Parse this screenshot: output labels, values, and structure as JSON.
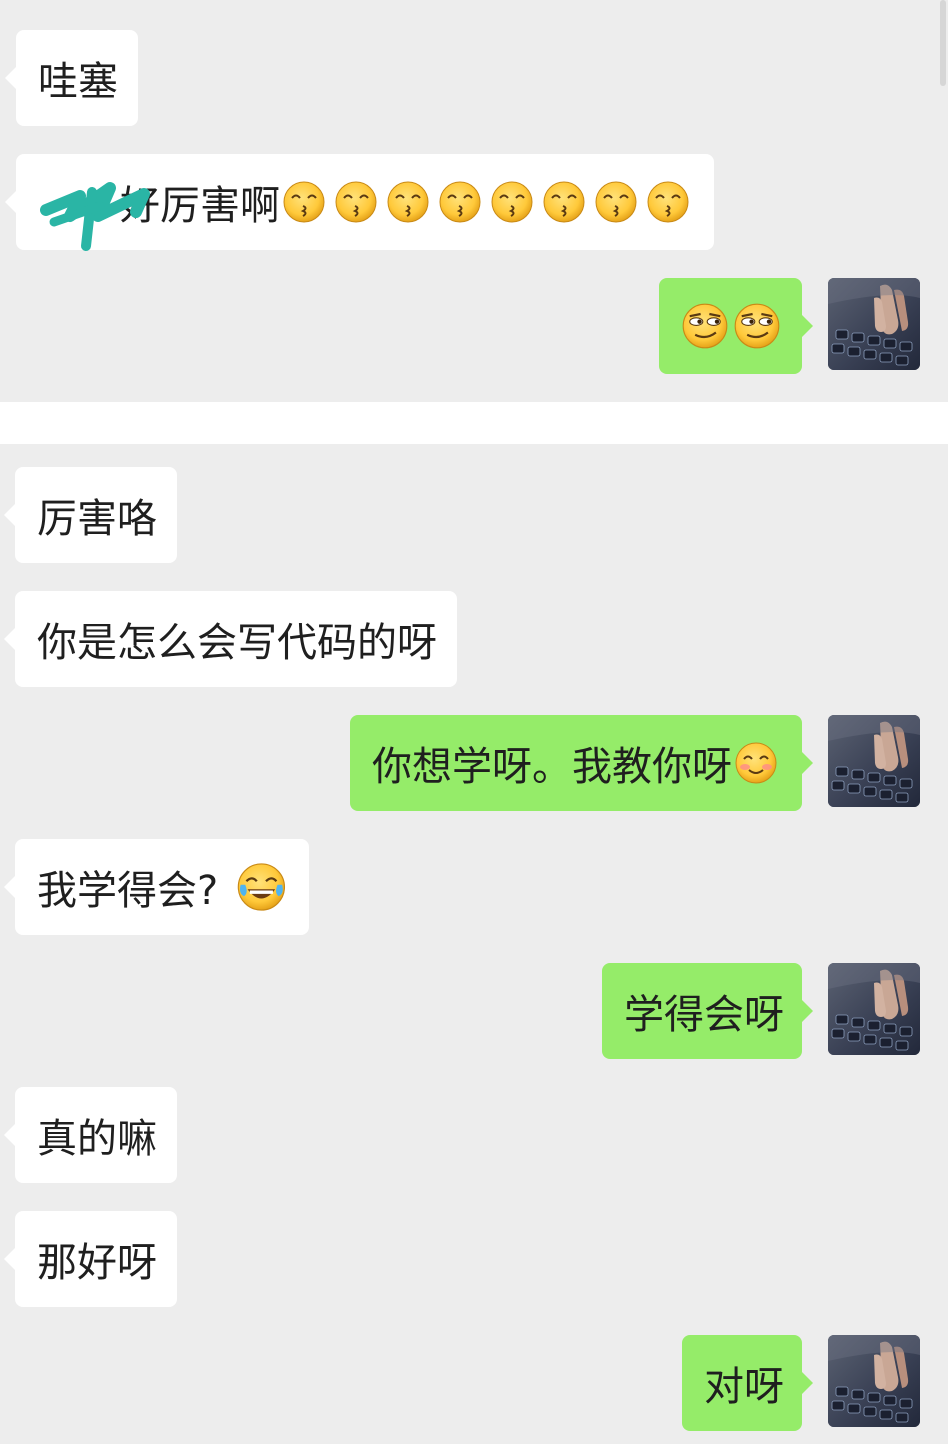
{
  "conversation": {
    "messages": [
      {
        "side": "left",
        "text": "哇塞"
      },
      {
        "side": "left",
        "text": "好厉害啊",
        "emoji": "kissing-emoji",
        "emoji_count": 8
      },
      {
        "side": "right",
        "emoji": "smirk-emoji",
        "emoji_count": 2
      },
      {
        "side": "left",
        "text": "厉害咯"
      },
      {
        "side": "left",
        "text": "你是怎么会写代码的呀"
      },
      {
        "side": "right",
        "text": "你想学呀。我教你呀",
        "emoji": "blush-smile-emoji"
      },
      {
        "side": "left",
        "text": "我学得会?",
        "emoji": "tears-of-joy-emoji"
      },
      {
        "side": "right",
        "text": "学得会呀"
      },
      {
        "side": "left",
        "text": "真的嘛"
      },
      {
        "side": "left",
        "text": "那好呀"
      },
      {
        "side": "right",
        "text": "对呀"
      }
    ]
  },
  "avatar": {
    "icon": "keyboard-typing-photo-icon"
  },
  "colors": {
    "background": "#ededed",
    "incoming_bubble": "#ffffff",
    "outgoing_bubble": "#95ec69",
    "text": "#1f1f1f",
    "redaction_scribble": "#2ab5a5"
  }
}
